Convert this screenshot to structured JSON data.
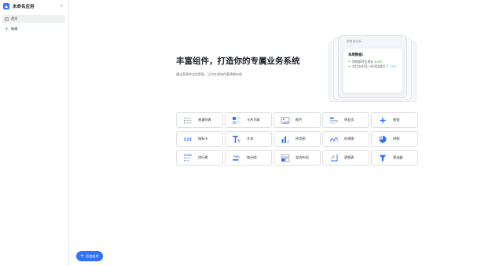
{
  "app": {
    "title": "未命名应用",
    "collapse_icon": "double-chevron-left-icon"
  },
  "sidebar": {
    "items": [
      {
        "label": "首页",
        "icon": "page-icon",
        "active": true
      },
      {
        "label": "新建",
        "icon": "plus-icon",
        "active": false
      }
    ]
  },
  "hero": {
    "title": "丰富组件，打造你的专属业务系统",
    "subtitle": "通过直观的业务界面，让内外部协作更清晰有效"
  },
  "preview_card": {
    "header": "销售部分析",
    "inner_title": "本周数据:",
    "line1_prefix": "销售额环比增长",
    "line1_value": "6.8%",
    "line2_prefix": "对比去年同一时间段提升了",
    "line2_value": "25%"
  },
  "widgets": [
    {
      "label": "普通列表",
      "icon": "list-icon"
    },
    {
      "label": "卡片列表",
      "icon": "card-list-icon"
    },
    {
      "label": "图片",
      "icon": "image-icon"
    },
    {
      "label": "明显页",
      "icon": "detail-page-icon"
    },
    {
      "label": "按钮",
      "icon": "plus-icon"
    },
    {
      "label": "指标卡",
      "icon": "metric-123-icon"
    },
    {
      "label": "文本",
      "icon": "text-icon"
    },
    {
      "label": "柱状图",
      "icon": "bar-chart-icon"
    },
    {
      "label": "折线图",
      "icon": "line-chart-icon"
    },
    {
      "label": "饼图",
      "icon": "pie-chart-icon"
    },
    {
      "label": "排行榜",
      "icon": "ranking-icon"
    },
    {
      "label": "统计图",
      "icon": "percent-chart-icon"
    },
    {
      "label": "混合布局",
      "icon": "mixed-layout-icon"
    },
    {
      "label": "透视表",
      "icon": "pivot-table-icon"
    },
    {
      "label": "筛选器",
      "icon": "filter-icon"
    }
  ],
  "add_button": {
    "label": "添加组件"
  },
  "colors": {
    "accent": "#3370ff",
    "green": "#2ea121",
    "cyan": "#14c0ff"
  }
}
